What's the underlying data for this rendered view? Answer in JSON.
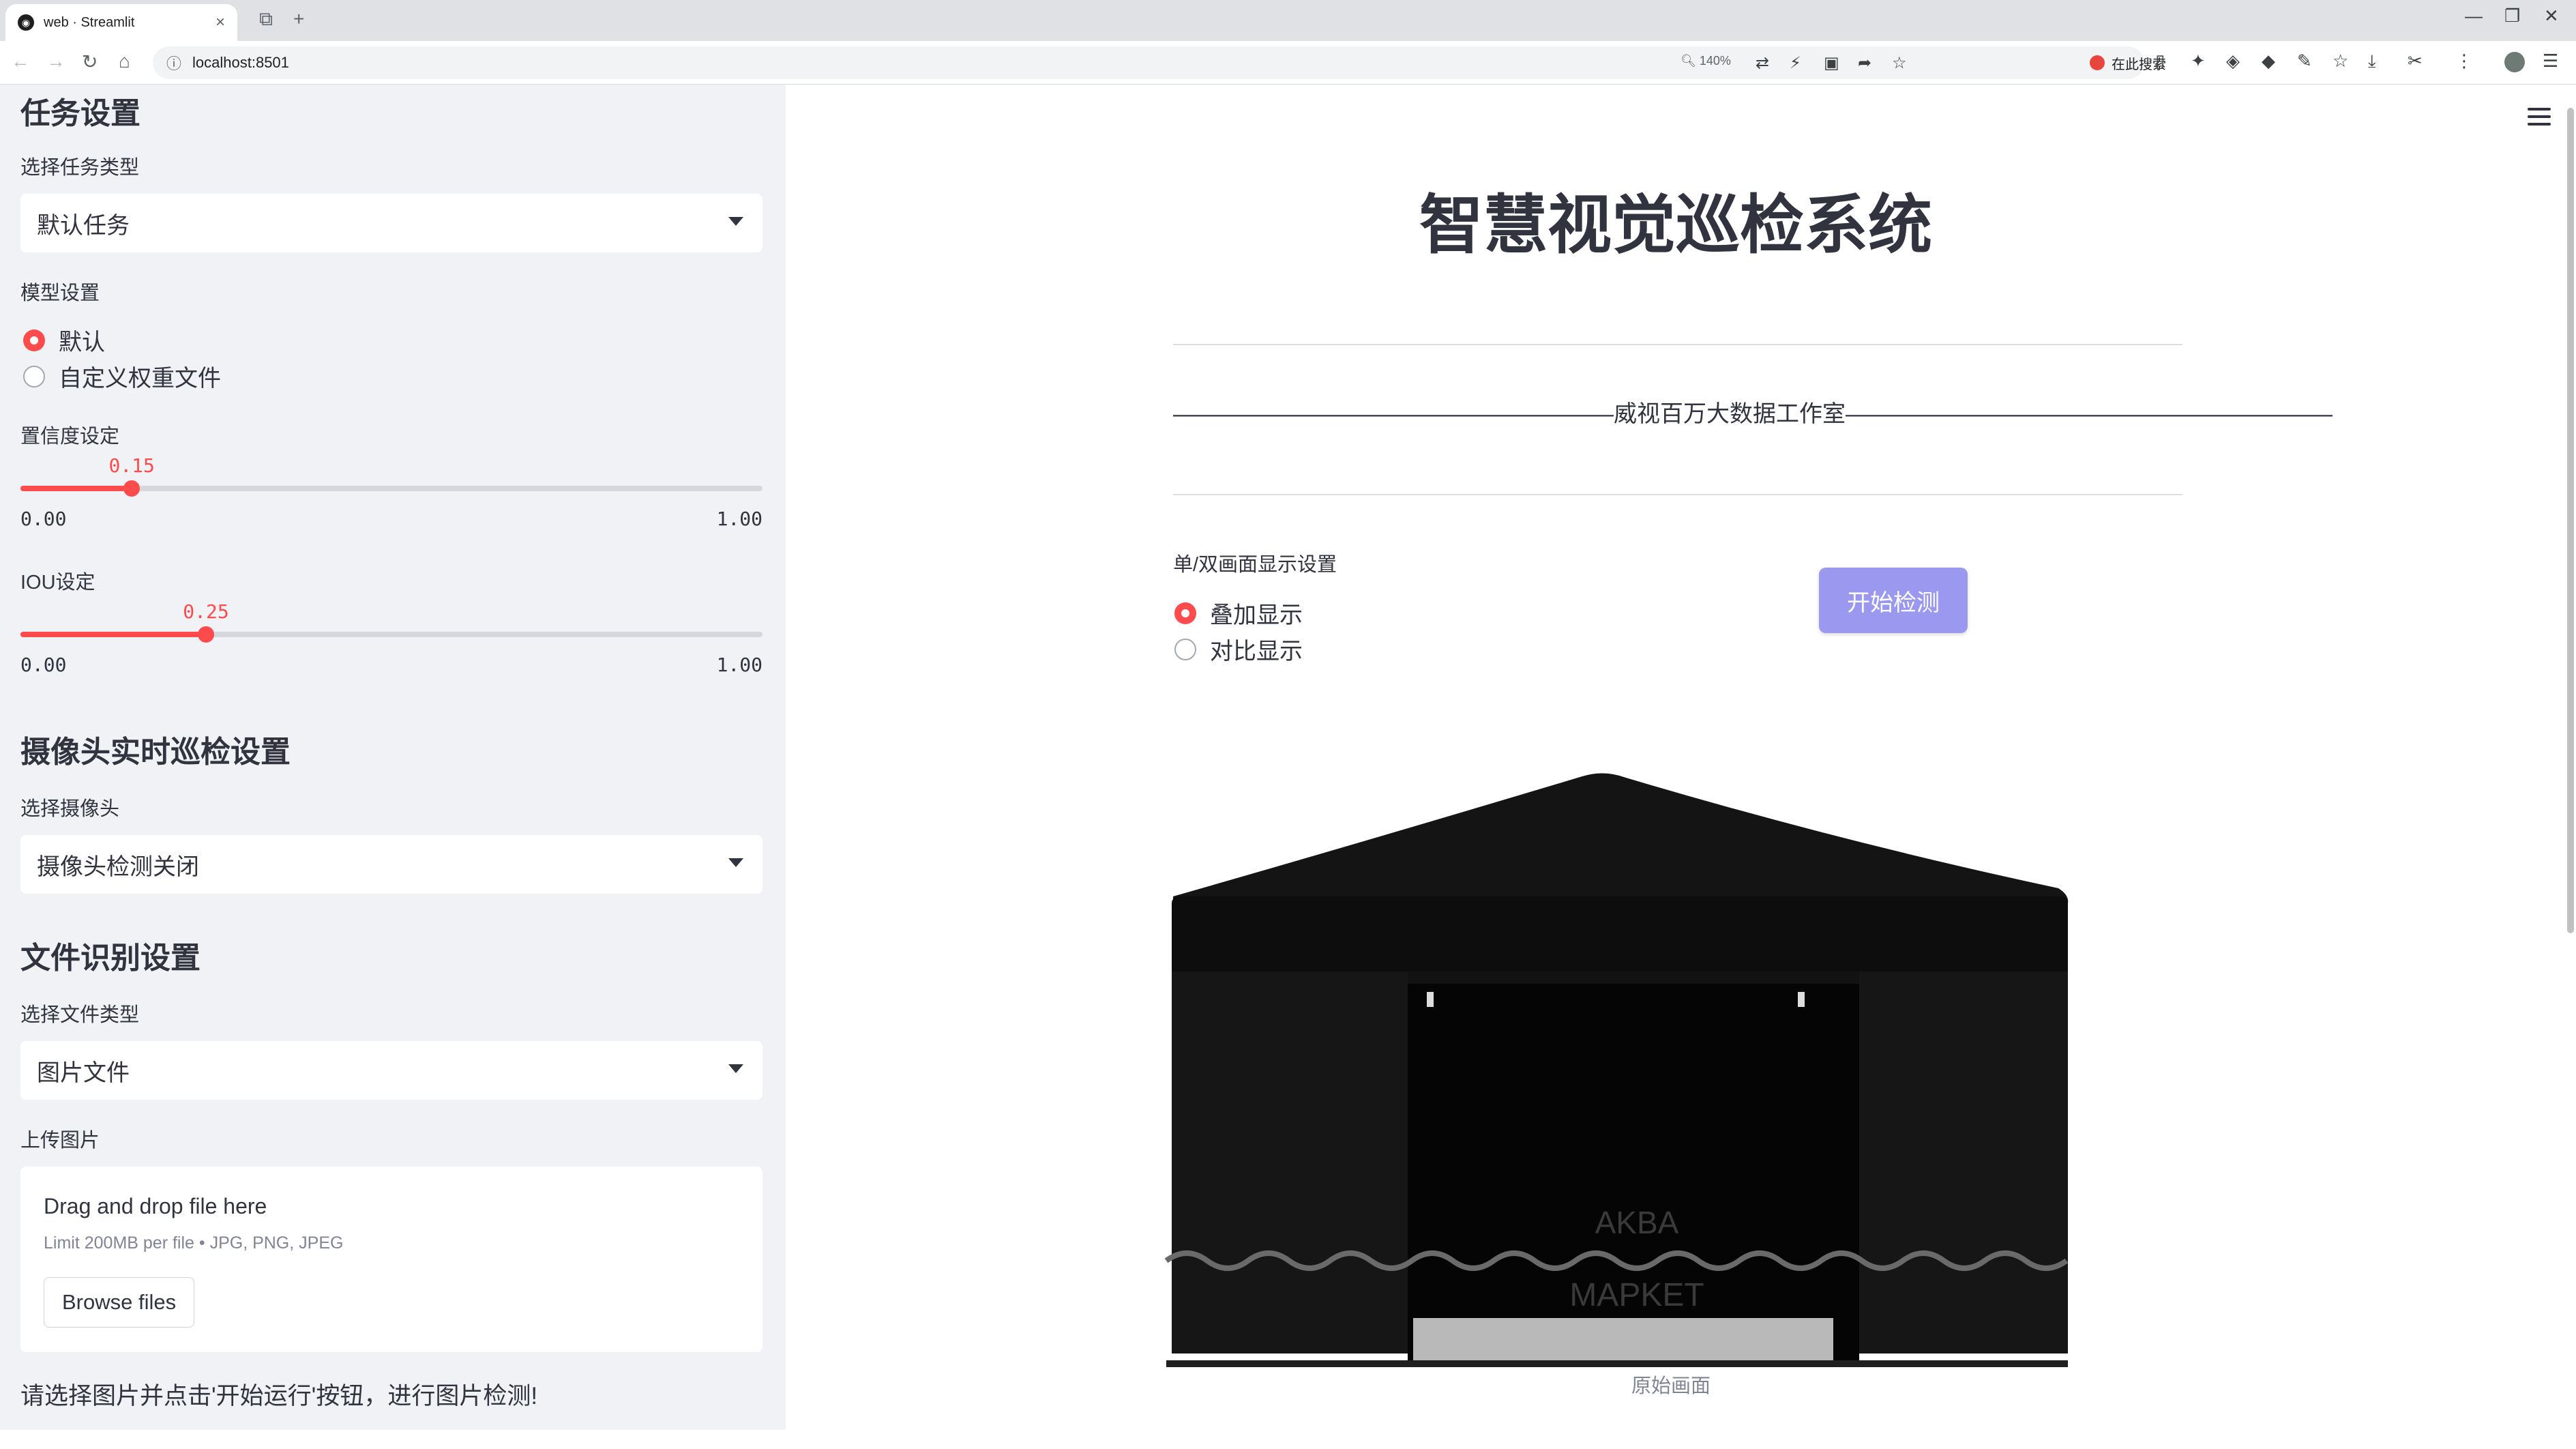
{
  "browser": {
    "tab_title": "web · Streamlit",
    "url": "localhost:8501",
    "zoom": "140%",
    "search_label": "在此搜索"
  },
  "sidebar": {
    "task_section": {
      "heading": "任务设置",
      "task_type_label": "选择任务类型",
      "task_type_value": "默认任务"
    },
    "model_section": {
      "label": "模型设置",
      "options": [
        "默认",
        "自定义权重文件"
      ],
      "selected_index": 0
    },
    "confidence": {
      "label": "置信度设定",
      "value": "0.15",
      "fraction": 0.15,
      "min": "0.00",
      "max": "1.00"
    },
    "iou": {
      "label": "IOU设定",
      "value": "0.25",
      "fraction": 0.25,
      "min": "0.00",
      "max": "1.00"
    },
    "camera_section": {
      "heading": "摄像头实时巡检设置",
      "label": "选择摄像头",
      "value": "摄像头检测关闭"
    },
    "file_section": {
      "heading": "文件识别设置",
      "file_type_label": "选择文件类型",
      "file_type_value": "图片文件",
      "upload_label": "上传图片",
      "drag_text": "Drag and drop file here",
      "limit_text": "Limit 200MB per file • JPG, PNG, JPEG",
      "browse_label": "Browse files"
    },
    "message": "请选择图片并点击'开始运行'按钮，进行图片检测!"
  },
  "main": {
    "title": "智慧视觉巡检系统",
    "subtitle": "———————————————————威视百万大数据工作室—————————————————————",
    "display_label": "单/双画面显示设置",
    "display_options": [
      "叠加显示",
      "对比显示"
    ],
    "display_selected_index": 0,
    "start_button": "开始检测",
    "image_texts": {
      "brand_top": "AKBA",
      "brand_bottom": "MAPKET"
    },
    "image_caption": "原始画面"
  },
  "colors": {
    "accent": "#ff4b4b",
    "button": "#9b98ef",
    "sidebar_bg": "#f0f2f6"
  }
}
